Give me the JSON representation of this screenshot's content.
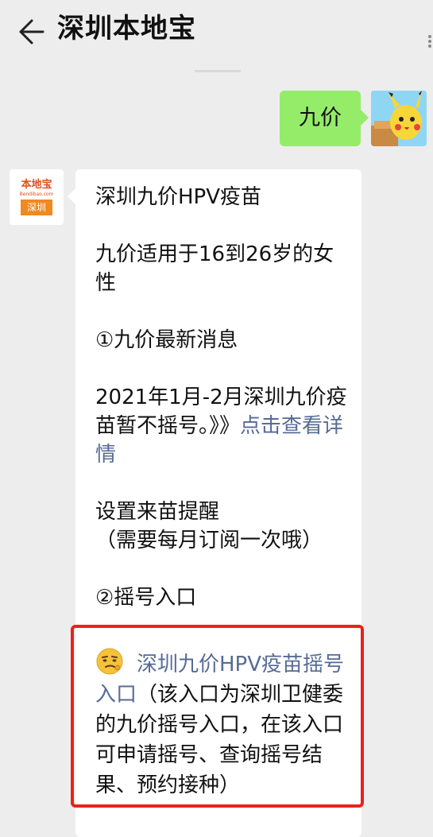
{
  "header": {
    "title": "深圳本地宝"
  },
  "sent": {
    "text": "九价"
  },
  "bot": {
    "logo_main": "本地宝",
    "logo_sub": "Bendibao.com",
    "logo_city": "深圳"
  },
  "reply": {
    "line1": "深圳九价HPV疫苗",
    "line2": "九价适用于16到26岁的女性",
    "line3": "①九价最新消息",
    "line4_text": "2021年1月-2月深圳九价疫苗暂不摇号。》》",
    "line4_link": "点击查看详情",
    "line5a": "设置来苗提醒",
    "line5b": "（需要每月订阅一次哦）",
    "line6": "②摇号入口",
    "entry_link": "深圳九价HPV疫苗摇号入口",
    "entry_text": "（该入口为深圳卫健委的九价摇号入口，在该入口可申请摇号、查询摇号结果、预约接种）"
  },
  "colors": {
    "bg": "#ededed",
    "sent_bubble": "#95ec69",
    "link": "#576b95",
    "highlight_border": "#e8221b"
  },
  "icons": {
    "back": "back-arrow-icon",
    "more": "more-dots-icon",
    "emoji": "smirk-emoji-icon"
  }
}
